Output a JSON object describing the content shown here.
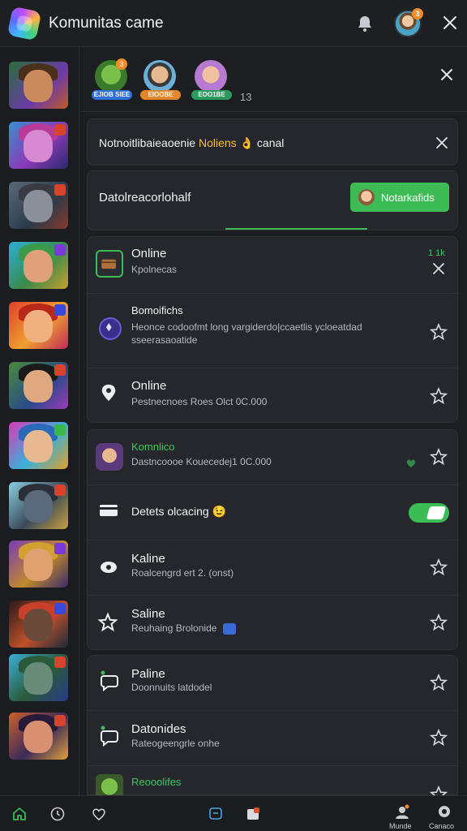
{
  "header": {
    "title": "Komunitas came",
    "avatar_badge": "3"
  },
  "friends": [
    {
      "label": "EJIOB SIEE",
      "color": "#2f6fd6",
      "badge": "3"
    },
    {
      "label": "EIOOBE",
      "color": "#e2872b",
      "badge": ""
    },
    {
      "label": "EOO1BE",
      "color": "#2c9a5c",
      "badge": ""
    }
  ],
  "friends_count": "13",
  "notice": {
    "text_main": "Notnoitlibaieaoenie ",
    "text_highlight": "Noliens ",
    "emoji": "👌",
    "text_tail": " canal"
  },
  "promo": {
    "text": "Datolreacorlohalf",
    "button_label": "Notarkafids"
  },
  "card1": {
    "rows": [
      {
        "title": "Online",
        "sub": "Kpolnecas",
        "extra": "1 1k"
      },
      {
        "title": "Bomoifichs",
        "sub": "Heonce codoofmt long vargiderdo|ccaetlis ycloeatdad",
        "sub2": "sseerasaoatide"
      },
      {
        "title": "Online",
        "sub": "Pestnecnoes  Roes  Olct 0C.000"
      }
    ]
  },
  "card2": {
    "rows": [
      {
        "title": "Komnlico",
        "sub": "Dastncoooe  Kouecedej1 0C.000"
      },
      {
        "title": "Detets olcacing",
        "emoji": "😉"
      },
      {
        "title": "Kaline",
        "sub": "Roalcengrd ert 2. (onst)"
      },
      {
        "title": "Saline",
        "sub": "Reuhaing Brolonide"
      }
    ]
  },
  "card3": {
    "rows": [
      {
        "title": "Paline",
        "sub": "Doonnuits latdodel"
      },
      {
        "title": "Datonides",
        "sub": "Rateogeengrle onhe"
      },
      {
        "title": "Reooolifes",
        "sub": ""
      }
    ]
  },
  "bottom_nav": {
    "profile_label": "Munde",
    "settings_label": "Canaco"
  },
  "colors": {
    "accent_green": "#3dbb55",
    "accent_orange": "#f28c28",
    "highlight_yellow": "#f1c232",
    "background": "#1b1d21",
    "card": "#25272c"
  }
}
